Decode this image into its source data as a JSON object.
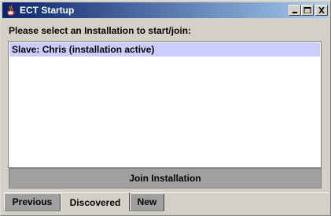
{
  "window": {
    "title": "ECT Startup",
    "controls": [
      "minimize",
      "maximize",
      "close"
    ]
  },
  "prompt": "Please select an Installation to start/join:",
  "installations": [
    {
      "label": "Slave: Chris (installation active)",
      "selected": true
    }
  ],
  "join_button": "Join Installation",
  "tabs": [
    {
      "label": "Previous",
      "active": false
    },
    {
      "label": "Discovered",
      "active": true
    },
    {
      "label": "New",
      "active": false
    }
  ],
  "colors": {
    "titlebar_start": "#0a246a",
    "titlebar_end": "#a6caf0",
    "selection": "#ccccff",
    "window_bg": "#d4d0c8"
  }
}
